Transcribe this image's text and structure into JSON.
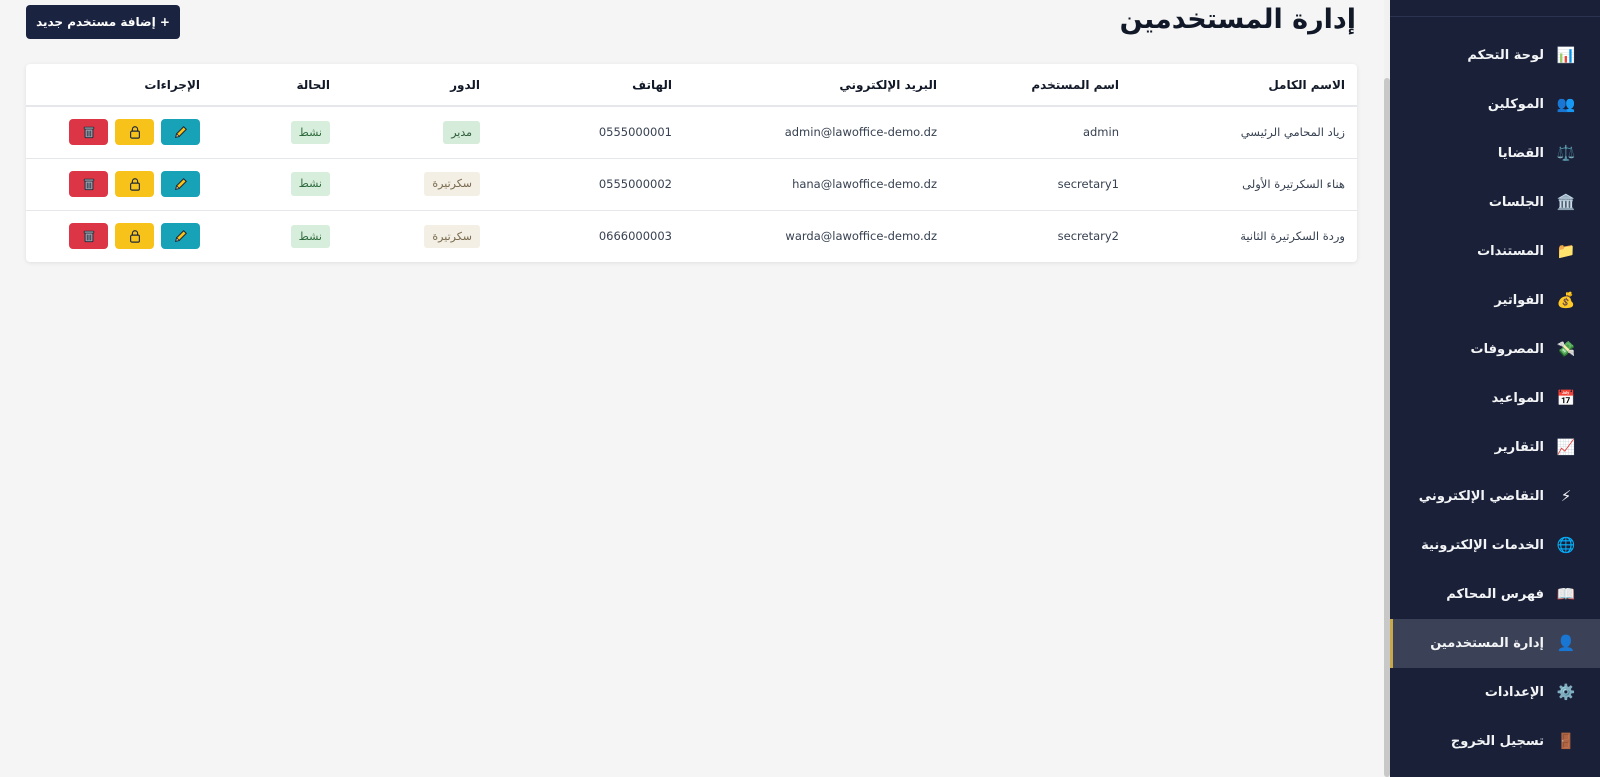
{
  "page": {
    "title": "إدارة المستخدمين",
    "add_button_label": "+ إضافة مستخدم جديد"
  },
  "table": {
    "headers": [
      "الاسم الكامل",
      "اسم المستخدم",
      "البريد الإلكتروني",
      "الهاتف",
      "الدور",
      "الحالة",
      "الإجراءات"
    ],
    "rows": [
      {
        "full_name": "زياد المحامي الرئيسي",
        "username": "admin",
        "email": "admin@lawoffice-demo.dz",
        "phone": "0555000001",
        "role": "مدير",
        "status": "نشط"
      },
      {
        "full_name": "هناء السكرتيرة الأولى",
        "username": "secretary1",
        "email": "hana@lawoffice-demo.dz",
        "phone": "0555000002",
        "role": "سكرتيرة",
        "status": "نشط"
      },
      {
        "full_name": "وردة السكرتيرة الثانية",
        "username": "secretary2",
        "email": "warda@lawoffice-demo.dz",
        "phone": "0666000003",
        "role": "سكرتيرة",
        "status": "نشط"
      }
    ]
  },
  "sidebar": {
    "items": [
      {
        "label": "لوحة التحكم",
        "icon": "bar-chart-icon",
        "glyph": "📊"
      },
      {
        "label": "الموكلين",
        "icon": "clients-icon",
        "glyph": "👥"
      },
      {
        "label": "القضايا",
        "icon": "scales-icon",
        "glyph": "⚖️"
      },
      {
        "label": "الجلسات",
        "icon": "courthouse-icon",
        "glyph": "🏛️"
      },
      {
        "label": "المستندات",
        "icon": "folder-icon",
        "glyph": "📁"
      },
      {
        "label": "الفواتير",
        "icon": "money-bag-icon",
        "glyph": "💰"
      },
      {
        "label": "المصروفات",
        "icon": "money-wings-icon",
        "glyph": "💸"
      },
      {
        "label": "المواعيد",
        "icon": "calendar-icon",
        "glyph": "📅"
      },
      {
        "label": "التقارير",
        "icon": "trend-chart-icon",
        "glyph": "📈"
      },
      {
        "label": "التقاضي الإلكتروني",
        "icon": "lightning-icon",
        "glyph": "⚡"
      },
      {
        "label": "الخدمات الإلكترونية",
        "icon": "globe-icon",
        "glyph": "🌐"
      },
      {
        "label": "فهرس المحاكم",
        "icon": "book-icon",
        "glyph": "📖"
      },
      {
        "label": "إدارة المستخدمين",
        "icon": "user-icon",
        "glyph": "👤",
        "active": true
      },
      {
        "label": "الإعدادات",
        "icon": "gear-icon",
        "glyph": "⚙️"
      },
      {
        "label": "تسجيل الخروج",
        "icon": "door-icon",
        "glyph": "🚪"
      }
    ]
  }
}
